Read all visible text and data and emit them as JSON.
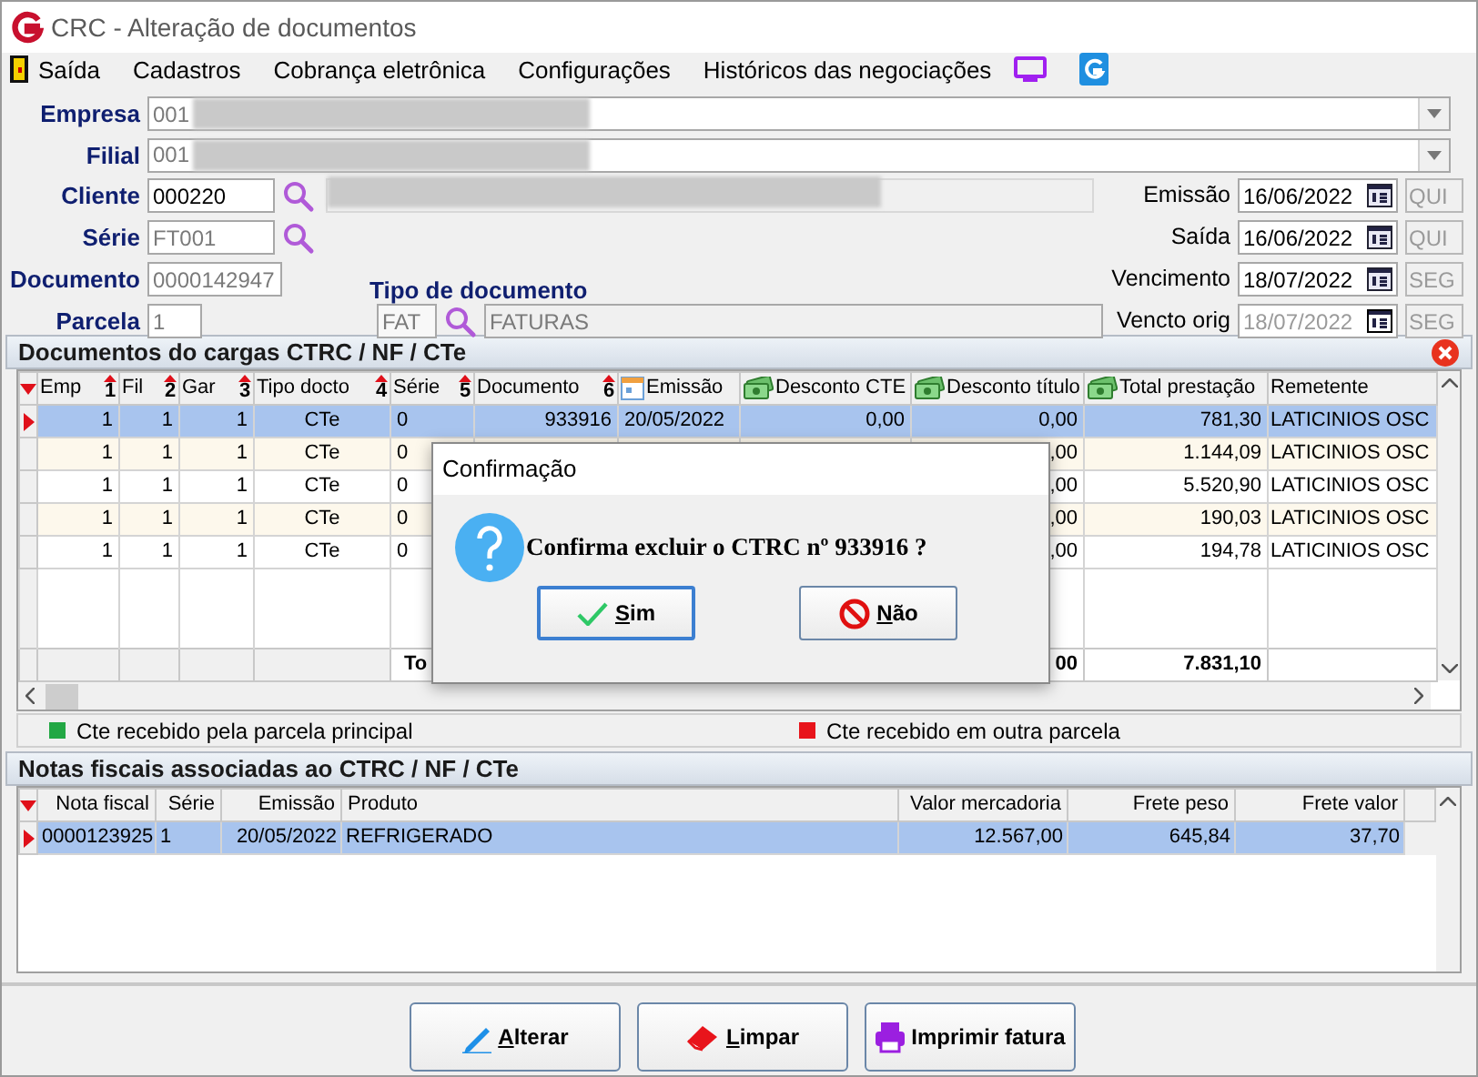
{
  "window": {
    "title": "CRC - Alteração de documentos"
  },
  "menu": [
    {
      "label": "Saída"
    },
    {
      "label": "Cadastros"
    },
    {
      "label": "Cobrança eletrônica"
    },
    {
      "label": "Configurações"
    },
    {
      "label": "Históricos das negociações"
    }
  ],
  "form": {
    "empresa": {
      "label": "Empresa",
      "code": "001"
    },
    "filial": {
      "label": "Filial",
      "code": "001"
    },
    "cliente": {
      "label": "Cliente",
      "code": "000220",
      "disabled": false
    },
    "serie": {
      "label": "Série",
      "value": "FT001",
      "disabled": true
    },
    "documento": {
      "label": "Documento",
      "value": "0000142947",
      "disabled": true
    },
    "parcela": {
      "label": "Parcela",
      "value": "1",
      "disabled": true
    },
    "tipo_documento": {
      "label": "Tipo de documento",
      "code": "FAT",
      "name": "FATURAS"
    },
    "dates": [
      {
        "label": "Emissão",
        "value": "16/06/2022",
        "weekday": "QUI",
        "disabled": false
      },
      {
        "label": "Saída",
        "value": "16/06/2022",
        "weekday": "QUI",
        "disabled": false
      },
      {
        "label": "Vencimento",
        "value": "18/07/2022",
        "weekday": "SEG",
        "disabled": false
      },
      {
        "label": "Vencto orig",
        "value": "18/07/2022",
        "weekday": "SEG",
        "disabled": true
      }
    ]
  },
  "documents_panel": {
    "title": "Documentos do cargas CTRC / NF / CTe",
    "columns": [
      {
        "label": "Emp",
        "sort": "1"
      },
      {
        "label": "Fil",
        "sort": "2"
      },
      {
        "label": "Gar",
        "sort": "3"
      },
      {
        "label": "Tipo docto",
        "sort": "4"
      },
      {
        "label": "Série",
        "sort": "5"
      },
      {
        "label": "Documento",
        "sort": "6"
      },
      {
        "label": "Emissão"
      },
      {
        "label": "Desconto CTE"
      },
      {
        "label": "Desconto título"
      },
      {
        "label": "Total prestação"
      },
      {
        "label": "Remetente"
      }
    ],
    "rows": [
      {
        "selected": true,
        "cells": [
          "1",
          "1",
          "1",
          "CTe",
          "0",
          "933916",
          "20/05/2022",
          "0,00",
          "0,00",
          "781,30",
          "LATICINIOS OSC"
        ]
      },
      {
        "selected": false,
        "cells": [
          "1",
          "1",
          "1",
          "CTe",
          "0",
          null,
          null,
          null,
          ",00",
          "1.144,09",
          "LATICINIOS OSC"
        ]
      },
      {
        "selected": false,
        "cells": [
          "1",
          "1",
          "1",
          "CTe",
          "0",
          null,
          null,
          null,
          ",00",
          "5.520,90",
          "LATICINIOS OSC"
        ]
      },
      {
        "selected": false,
        "cells": [
          "1",
          "1",
          "1",
          "CTe",
          "0",
          null,
          null,
          null,
          ",00",
          "190,03",
          "LATICINIOS OSC"
        ]
      },
      {
        "selected": false,
        "cells": [
          "1",
          "1",
          "1",
          "CTe",
          "0",
          null,
          null,
          null,
          ",00",
          "194,78",
          "LATICINIOS OSC"
        ]
      }
    ],
    "totals": {
      "label": "To",
      "discount_title": "00",
      "total": "7.831,10"
    },
    "legend": [
      {
        "label": "Cte recebido pela parcela principal",
        "color": "#22a744"
      },
      {
        "label": "Cte recebido em outra parcela",
        "color": "#e8141b"
      }
    ]
  },
  "notes_panel": {
    "title": "Notas fiscais associadas ao CTRC / NF / CTe",
    "columns": [
      "Nota fiscal",
      "Série",
      "Emissão",
      "Produto",
      "Valor mercadoria",
      "Frete peso",
      "Frete valor"
    ],
    "rows": [
      {
        "selected": true,
        "cells": [
          "0000123925",
          "1",
          "20/05/2022",
          "REFRIGERADO",
          "12.567,00",
          "645,84",
          "37,70"
        ]
      }
    ]
  },
  "buttons": [
    {
      "label": "Alterar",
      "underline_first": true
    },
    {
      "label": "Limpar",
      "underline_first": true
    },
    {
      "label": "Imprimir fatura",
      "underline_first": false
    }
  ],
  "dialog": {
    "title": "Confirmação",
    "message": "Confirma excluir o CTRC nº 933916 ?",
    "buttons": [
      {
        "label": "Sim",
        "focused": true,
        "underline_first": true
      },
      {
        "label": "Não",
        "focused": false,
        "underline_first": true
      }
    ]
  }
}
